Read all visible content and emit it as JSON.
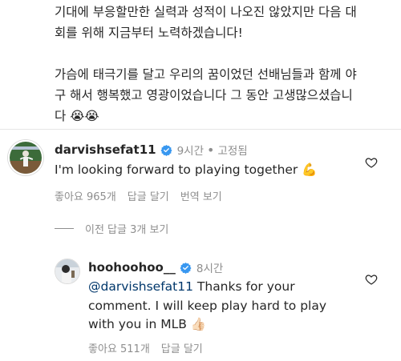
{
  "caption": {
    "p1_line1": "기대에 부응할만한 실력과 성적이 나오진 않았지만 다음 대",
    "p1_line2": "회를 위해 지금부터 노력하겠습니다!",
    "p2_line1": "가슴에 태극기를 달고 우리의 꿈이었던 선배님들과 함께 야",
    "p2_line2": "구 해서 행복했고 영광이었습니다 그 동안 고생많으셨습니",
    "p2_line3_text": "다",
    "emoji": "😭😭"
  },
  "comment": {
    "username": "darvishsefat11",
    "time": "9시간",
    "pinned": "고정됨",
    "text": "I'm looking forward to playing together",
    "emoji": "💪",
    "likes": "좋아요 965개",
    "reply": "답글 달기",
    "translate": "번역 보기"
  },
  "view_previous": "이전 답글 3개 보기",
  "reply": {
    "username": "hoohoohoo__",
    "time": "8시간",
    "mention": "@darvishsefat11",
    "text_line1": " Thanks for your",
    "text_line2": "comment. I will keep play hard to play",
    "text_line3": "with you in MLB",
    "emoji": "👍🏻",
    "likes": "좋아요 511개",
    "reply_action": "답글 달기"
  },
  "colors": {
    "verified": "#3897f0",
    "secondary_text": "#8e8e8e",
    "mention": "#00376b"
  }
}
